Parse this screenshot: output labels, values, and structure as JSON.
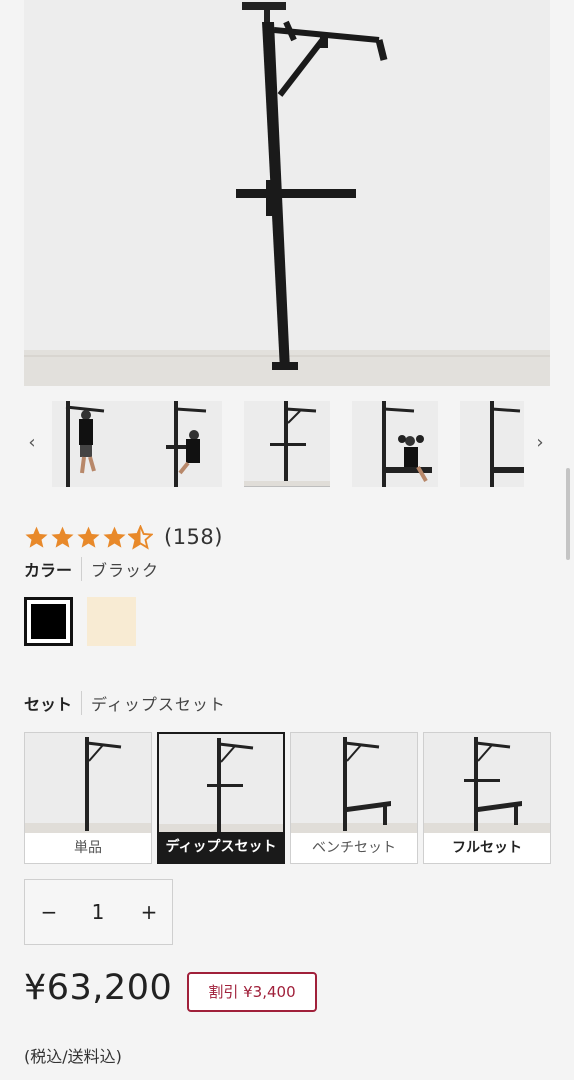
{
  "gallery": {
    "prev_icon": "chevron-left-icon",
    "next_icon": "chevron-right-icon",
    "thumbnails": [
      {
        "name": "thumb-pullup"
      },
      {
        "name": "thumb-dips"
      },
      {
        "name": "thumb-dips-set"
      },
      {
        "name": "thumb-bench-press"
      },
      {
        "name": "thumb-bench"
      }
    ],
    "active_index": 2
  },
  "rating": {
    "stars": 4.5,
    "count_text": "(158)",
    "star_color": "#e8892a"
  },
  "color_option": {
    "label": "カラー",
    "selected_value": "ブラック",
    "swatches": [
      {
        "name": "black",
        "hex": "#000000",
        "selected": true
      },
      {
        "name": "cream",
        "hex": "#f8ebd3",
        "selected": false
      }
    ]
  },
  "set_option": {
    "label": "セット",
    "selected_value": "ディップスセット",
    "cards": [
      {
        "label": "単品",
        "selected": false
      },
      {
        "label": "ディップスセット",
        "selected": true
      },
      {
        "label": "ベンチセット",
        "selected": false
      },
      {
        "label": "フルセット",
        "selected": false
      }
    ]
  },
  "quantity": {
    "minus": "−",
    "value": "1",
    "plus": "+"
  },
  "pricing": {
    "price": "¥63,200",
    "discount": "割引 ¥3,400",
    "tax_note": "(税込/送料込)",
    "discount_color": "#a0203a"
  }
}
